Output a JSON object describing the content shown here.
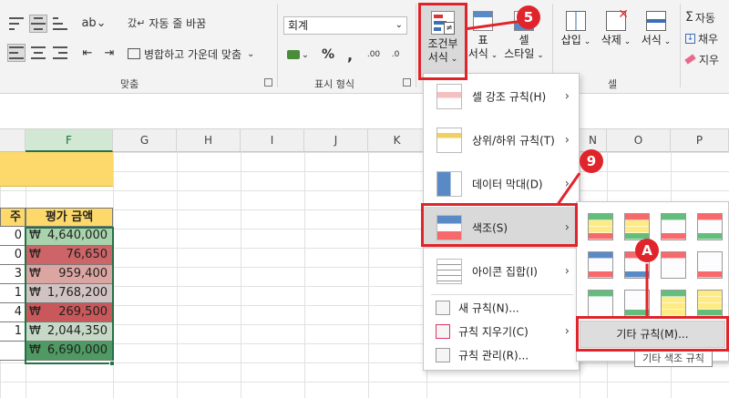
{
  "ribbon": {
    "wrap_text": "자동 줄 바꿈",
    "merge_center": "병합하고 가운데 맞춤",
    "number_format": "회계",
    "percent": "%",
    "comma": ",",
    "cond_format": [
      "조건부",
      "서식"
    ],
    "table_format": [
      "표",
      "서식"
    ],
    "cell_styles": [
      "셀",
      "스타일"
    ],
    "insert": "삽입",
    "delete": "삭제",
    "format": "서식",
    "autosum": "자동",
    "fill": "채우",
    "clear": "지우",
    "groups": {
      "alignment": "맞춤",
      "number": "표시 형식",
      "cells": "셀"
    }
  },
  "columns": [
    "F",
    "G",
    "H",
    "I",
    "J",
    "K",
    "N",
    "O",
    "P"
  ],
  "sheet": {
    "left_header": "주",
    "amount_header": "평가 금액",
    "left_digits": [
      "0",
      "0",
      "3",
      "1",
      "4",
      "1",
      ""
    ],
    "currency": "₩",
    "amounts": [
      "4,640,000",
      "76,650",
      "959,400",
      "1,768,200",
      "269,500",
      "2,044,350",
      "6,690,000"
    ],
    "amount_colors": [
      "#a9d3ac",
      "#cd6467",
      "#dba5a2",
      "#d2c3c3",
      "#c8585a",
      "#c6d9c6",
      "#4e9a62"
    ]
  },
  "menu": {
    "items": [
      {
        "label": "셀 강조 규칙(H)",
        "has_sub": true
      },
      {
        "label": "상위/하위 규칙(T)",
        "has_sub": true
      },
      {
        "label": "데이터 막대(D)",
        "has_sub": true
      },
      {
        "label": "색조(S)",
        "has_sub": true
      },
      {
        "label": "아이콘 집합(I)",
        "has_sub": true
      }
    ],
    "small_items": [
      {
        "label": "새 규칙(N)..."
      },
      {
        "label": "규칙 지우기(C)",
        "has_sub": true
      },
      {
        "label": "규칙 관리(R)..."
      }
    ],
    "arrow": "›"
  },
  "submenu": {
    "more_rules": "기타 규칙(M)...",
    "tooltip": "기타 색조 규칙",
    "scales": [
      [
        "#63be7b",
        "#ffeb84",
        "#f8696b"
      ],
      [
        "#f8696b",
        "#ffeb84",
        "#63be7b"
      ],
      [
        "#63be7b",
        "#fcfcff",
        "#f8696b"
      ],
      [
        "#f8696b",
        "#fcfcff",
        "#63be7b"
      ],
      [
        "#5a8ac6",
        "#fcfcff",
        "#f8696b"
      ],
      [
        "#f8696b",
        "#fcfcff",
        "#5a8ac6"
      ],
      [
        "#f8696b",
        "#fcfcff",
        "#fcfcff"
      ],
      [
        "#fcfcff",
        "#fcfcff",
        "#f8696b"
      ],
      [
        "#63be7b",
        "#fcfcff",
        "#fcfcff"
      ],
      [
        "#fcfcff",
        "#fcfcff",
        "#63be7b"
      ],
      [
        "#63be7b",
        "#ffeb84",
        "#ffeb84"
      ],
      [
        "#ffeb84",
        "#ffeb84",
        "#63be7b"
      ]
    ]
  },
  "callouts": {
    "step5": "5",
    "step9": "9",
    "stepA": "A",
    "color": "#e0242b"
  }
}
